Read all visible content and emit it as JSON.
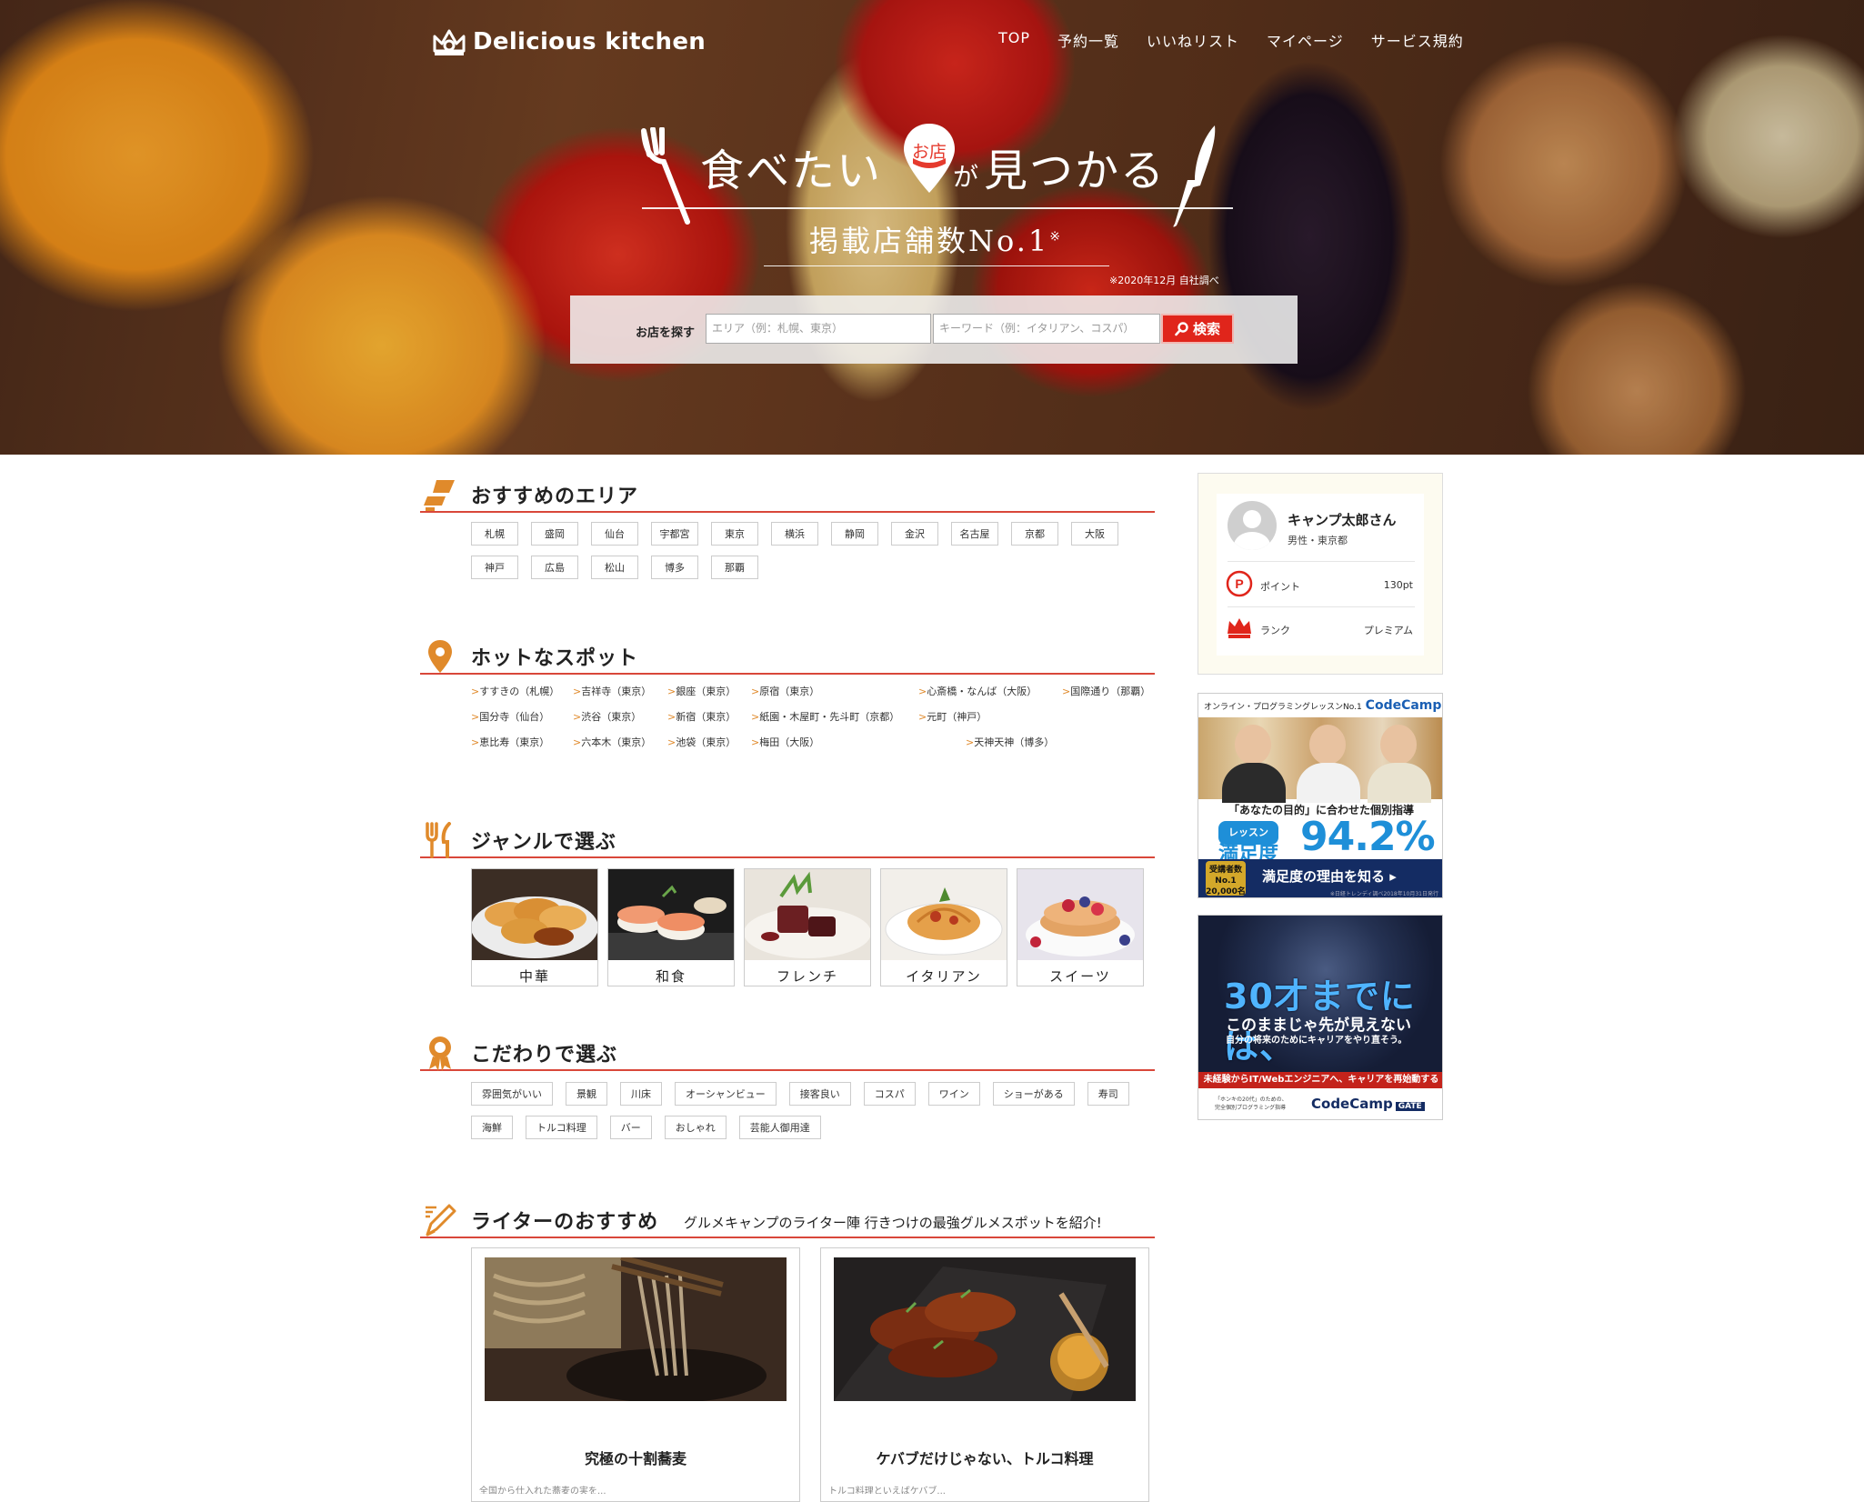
{
  "header": {
    "logo_text": "Delicious kitchen",
    "nav": [
      "TOP",
      "予約一覧",
      "いいねリスト",
      "マイページ",
      "サービス規約"
    ]
  },
  "hero": {
    "catch_left": "食べたい",
    "catch_pin": "お店",
    "catch_ga": "が",
    "catch_right": "見つかる",
    "sub": "掲載店舗数No.1",
    "sub_mark": "※",
    "note": "※2020年12月 自社調べ"
  },
  "search": {
    "label": "お店を探す",
    "area_placeholder": "エリア（例：札幌、東京）",
    "keyword_placeholder": "キーワード（例：イタリアン、コスパ）",
    "button": "検索"
  },
  "areas": {
    "title": "おすすめのエリア",
    "items": [
      "札幌",
      "盛岡",
      "仙台",
      "宇都宮",
      "東京",
      "横浜",
      "静岡",
      "金沢",
      "名古屋",
      "京都",
      "大阪",
      "神戸",
      "広島",
      "松山",
      "博多",
      "那覇"
    ]
  },
  "spots": {
    "title": "ホットなスポット",
    "items": [
      "すすきの（札幌）",
      "吉祥寺（東京）",
      "銀座（東京）",
      "原宿（東京）",
      "心斎橋・なんば（大阪）",
      "国際通り（那覇）",
      "国分寺（仙台）",
      "渋谷（東京）",
      "新宿（東京）",
      "紙園・木屋町・先斗町（京都）",
      "元町（神戸）",
      "恵比寿（東京）",
      "六本木（東京）",
      "池袋（東京）",
      "梅田（大阪）",
      "天神天神（博多）"
    ]
  },
  "genres": {
    "title": "ジャンルで選ぶ",
    "items": [
      "中華",
      "和食",
      "フレンチ",
      "イタリアン",
      "スイーツ"
    ]
  },
  "kodawari": {
    "title": "こだわりで選ぶ",
    "items": [
      "雰囲気がいい",
      "景観",
      "川床",
      "オーシャンビュー",
      "接客良い",
      "コスパ",
      "ワイン",
      "ショーがある",
      "寿司",
      "海鮮",
      "トルコ料理",
      "バー",
      "おしゃれ",
      "芸能人御用達"
    ]
  },
  "writers": {
    "title": "ライターのおすすめ",
    "subtitle": "グルメキャンプのライター陣 行きつけの最強グルメスポットを紹介!",
    "cards": [
      {
        "title": "究極の十割蕎麦",
        "text": "全国から仕入れた蕎麦の実を..."
      },
      {
        "title": "ケバブだけじゃない、トルコ料理",
        "text": "トルコ料理といえばケバブ..."
      }
    ]
  },
  "profile": {
    "name": "キャンプ太郎さん",
    "meta": "男性・東京都",
    "point_label": "ポイント",
    "point_value": "130pt",
    "rank_label": "ランク",
    "rank_value": "プレミアム"
  },
  "banner1": {
    "top": "オンライン・プログラミングレッスンNo.1",
    "brand": "CodeCamp",
    "mid": "「あなたの目的」に合わせた個別指導",
    "rate_small": "レッスン",
    "rate_label": "満足度",
    "rate": "94.2%",
    "badge_top": "受講者数",
    "badge_mid": "No.1",
    "badge_bottom": "20,000名",
    "cta": "満足度の理由を知る ▸",
    "fine": "※日経トレンディ調べ2018年10月31日発行"
  },
  "banner2": {
    "big": "30才までには、",
    "mid": "このままじゃ先が見えない",
    "small": "自分の将来のためにキャリアをやり直そう。",
    "red": "未経験からIT/Webエンジニアへ、キャリアを再始動する",
    "fine1": "「ホンキの20代」のための、",
    "fine2": "完全個別プログラミング指導",
    "logo": "CodeCamp",
    "gate": "GATE"
  },
  "colors": {
    "accent_red": "#d9473a",
    "icon_orange": "#e08a2b",
    "search_red": "#e0251b",
    "codecamp_blue": "#1e8fd8"
  }
}
